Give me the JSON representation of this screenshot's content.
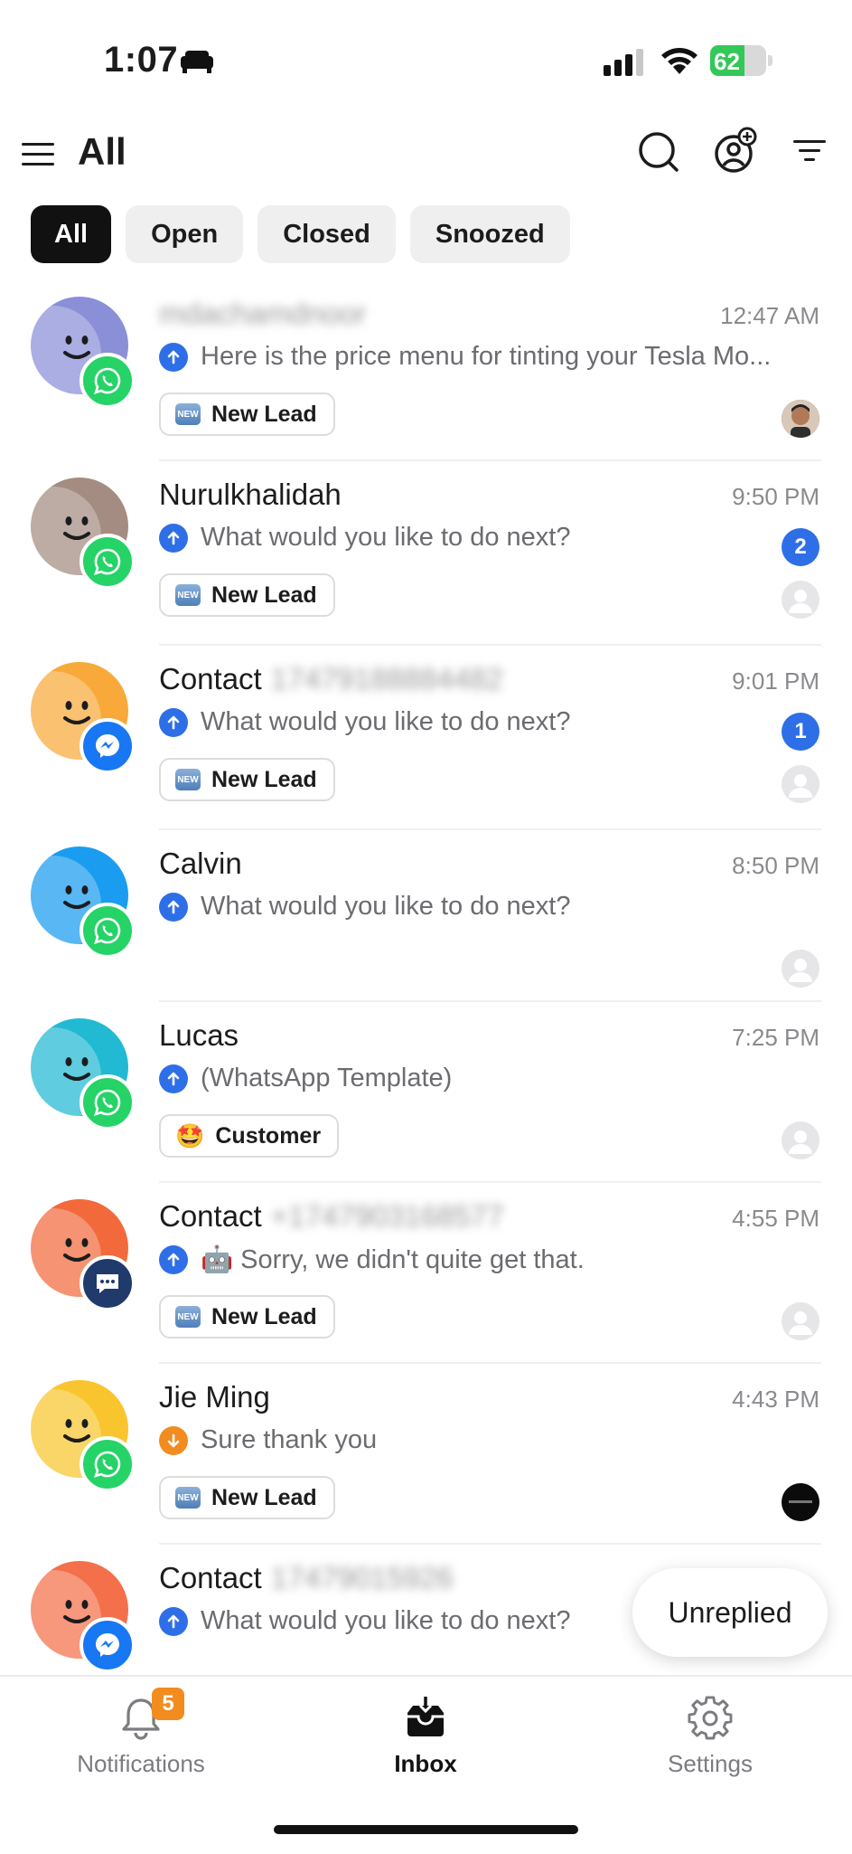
{
  "status_bar": {
    "time": "1:07",
    "battery": "62"
  },
  "header": {
    "title": "All"
  },
  "tabs": [
    "All",
    "Open",
    "Closed",
    "Snoozed"
  ],
  "conversations": [
    {
      "name": "",
      "name_blurred": "mdachamdnoor",
      "time": "12:47 AM",
      "preview": "Here is the price menu for tinting your Tesla Mo...",
      "direction": "outgoing",
      "tag": "New Lead",
      "channel": "whatsapp",
      "unread": null,
      "avatar_color": "#8a8fd8"
    },
    {
      "name": "Nurulkhalidah",
      "name_blurred": "",
      "time": "9:50 PM",
      "preview": "What would you like to do next?",
      "direction": "outgoing",
      "tag": "New Lead",
      "channel": "whatsapp",
      "unread": "2",
      "avatar_color": "#a48c82"
    },
    {
      "name": "Contact",
      "name_blurred": "17479188884482",
      "time": "9:01 PM",
      "preview": "What would you like to do next?",
      "direction": "outgoing",
      "tag": "New Lead",
      "channel": "messenger",
      "unread": "1",
      "avatar_color": "#f8a93a"
    },
    {
      "name": "Calvin",
      "name_blurred": "",
      "time": "8:50 PM",
      "preview": "What would you like to do next?",
      "direction": "outgoing",
      "tag": "",
      "channel": "whatsapp",
      "unread": null,
      "avatar_color": "#1a9cf0"
    },
    {
      "name": "Lucas",
      "name_blurred": "",
      "time": "7:25 PM",
      "preview": "(WhatsApp Template)",
      "direction": "outgoing",
      "tag": "Customer",
      "channel": "whatsapp",
      "unread": null,
      "avatar_color": "#22b9d3"
    },
    {
      "name": "Contact",
      "name_blurred": "+1747903168577",
      "time": "4:55 PM",
      "preview": "🤖 Sorry, we didn't quite get that.",
      "direction": "outgoing",
      "tag": "New Lead",
      "channel": "chat",
      "unread": null,
      "avatar_color": "#f26a3c"
    },
    {
      "name": "Jie Ming",
      "name_blurred": "",
      "time": "4:43 PM",
      "preview": "Sure thank you",
      "direction": "incoming",
      "tag": "New Lead",
      "channel": "whatsapp",
      "unread": null,
      "avatar_color": "#f9c52e"
    },
    {
      "name": "Contact",
      "name_blurred": "17479015926",
      "time": "",
      "preview": "What would you like to do next?",
      "direction": "outgoing",
      "tag": "",
      "channel": "messenger",
      "unread": null,
      "avatar_color": "#f4704a"
    }
  ],
  "floating_button": "Unreplied",
  "bottom_nav": {
    "notifications": {
      "label": "Notifications",
      "badge": "5"
    },
    "inbox": {
      "label": "Inbox"
    },
    "settings": {
      "label": "Settings"
    }
  },
  "colors": {
    "accent_blue": "#2e6fe8",
    "badge_orange": "#f28c1f",
    "whatsapp_green": "#25d366",
    "messenger_blue": "#1877f2"
  }
}
